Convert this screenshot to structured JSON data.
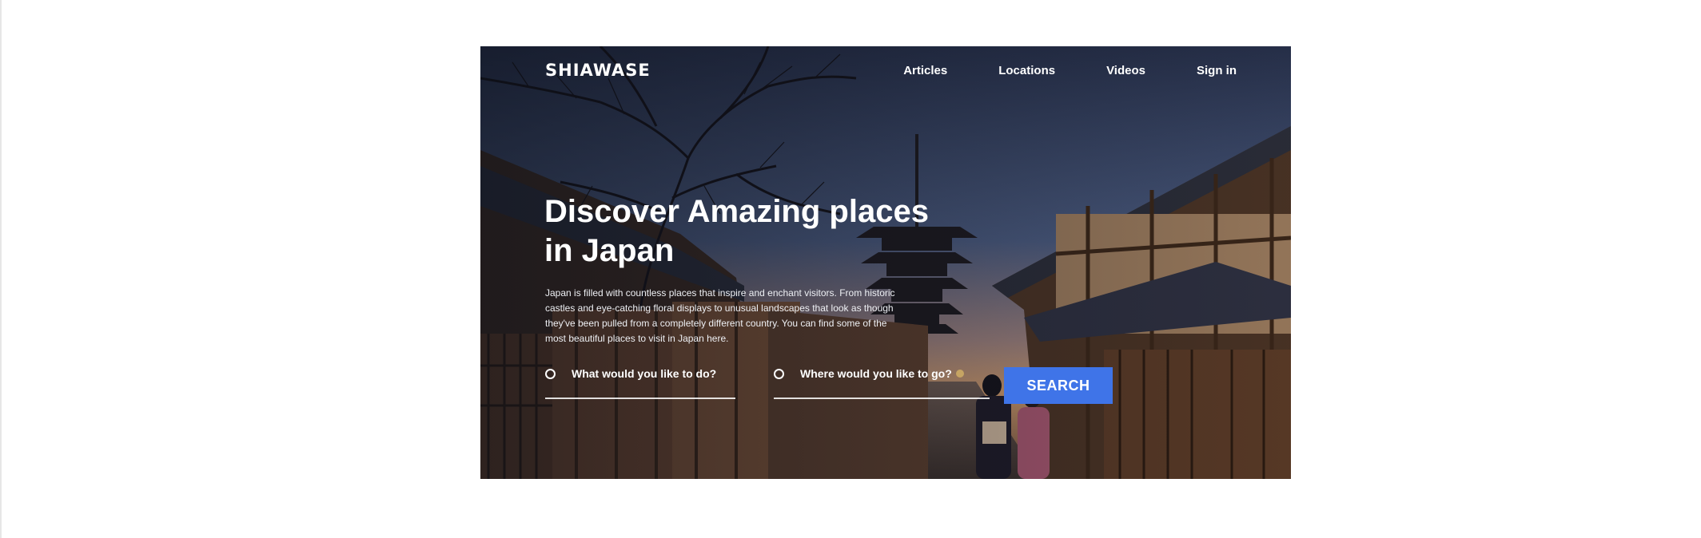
{
  "brand": {
    "logo_text": "SHIAWASE"
  },
  "nav": {
    "items": [
      {
        "label": "Articles"
      },
      {
        "label": "Locations"
      },
      {
        "label": "Videos"
      },
      {
        "label": "Sign in"
      }
    ]
  },
  "hero": {
    "headline": "Discover Amazing places in Japan",
    "description": "Japan is filled with countless places that inspire and enchant visitors. From historic castles and eye-catching floral displays to unusual landscapes that look as though they've been pulled from a completely different country. You can find some of the most beautiful places to visit in Japan here.",
    "image_subject": "Kyoto street at dusk with wooden houses, a pagoda and bare tree"
  },
  "search": {
    "activity_placeholder": "What would you like to do?",
    "location_placeholder": "Where would you like to go?",
    "button_label": "SEARCH"
  },
  "colors": {
    "accent": "#3f74e8",
    "text_on_hero": "#ffffff"
  }
}
